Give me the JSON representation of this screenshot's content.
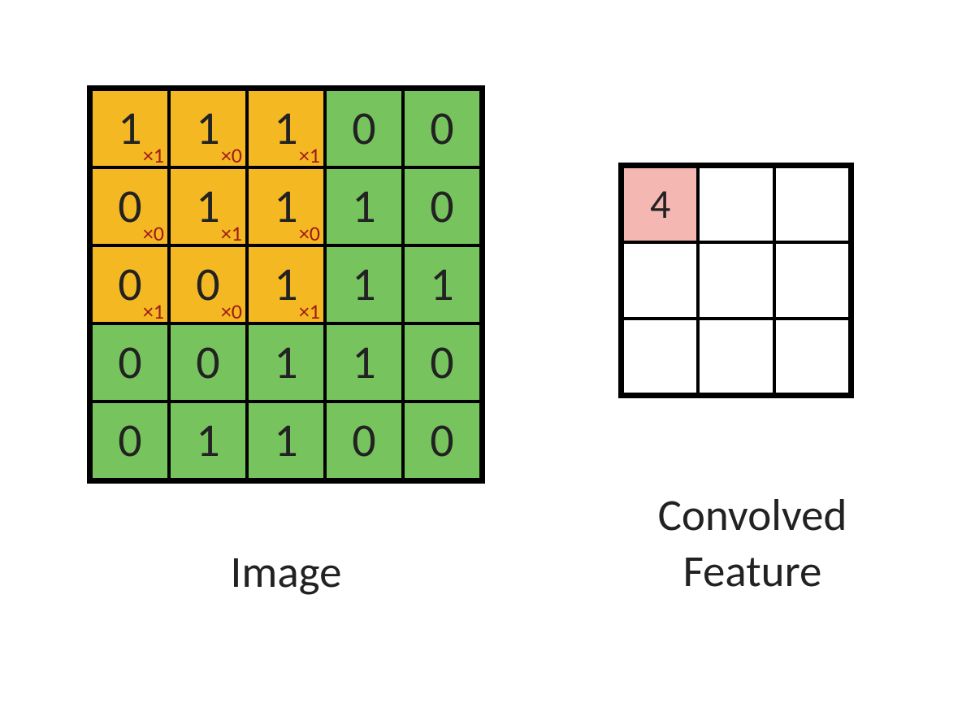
{
  "labels": {
    "image": "Image",
    "feature": "Convolved Feature"
  },
  "colors": {
    "image_cell": "#77c35d",
    "filter_cell": "#f4b823",
    "active_cell": "#f4b7b2",
    "empty_cell": "#ffffff",
    "weight_text": "#a01818",
    "border": "#000000"
  },
  "image_grid": {
    "rows": 5,
    "cols": 5,
    "filter_window": {
      "row0": 0,
      "col0": 0,
      "size": 3
    },
    "cells": [
      [
        {
          "v": "1",
          "w": "×1"
        },
        {
          "v": "1",
          "w": "×0"
        },
        {
          "v": "1",
          "w": "×1"
        },
        {
          "v": "0"
        },
        {
          "v": "0"
        }
      ],
      [
        {
          "v": "0",
          "w": "×0"
        },
        {
          "v": "1",
          "w": "×1"
        },
        {
          "v": "1",
          "w": "×0"
        },
        {
          "v": "1"
        },
        {
          "v": "0"
        }
      ],
      [
        {
          "v": "0",
          "w": "×1"
        },
        {
          "v": "0",
          "w": "×0"
        },
        {
          "v": "1",
          "w": "×1"
        },
        {
          "v": "1"
        },
        {
          "v": "1"
        }
      ],
      [
        {
          "v": "0"
        },
        {
          "v": "0"
        },
        {
          "v": "1"
        },
        {
          "v": "1"
        },
        {
          "v": "0"
        }
      ],
      [
        {
          "v": "0"
        },
        {
          "v": "1"
        },
        {
          "v": "1"
        },
        {
          "v": "0"
        },
        {
          "v": "0"
        }
      ]
    ]
  },
  "feature_grid": {
    "rows": 3,
    "cols": 3,
    "active": {
      "row": 0,
      "col": 0
    },
    "cells": [
      [
        {
          "v": "4"
        },
        {
          "v": ""
        },
        {
          "v": ""
        }
      ],
      [
        {
          "v": ""
        },
        {
          "v": ""
        },
        {
          "v": ""
        }
      ],
      [
        {
          "v": ""
        },
        {
          "v": ""
        },
        {
          "v": ""
        }
      ]
    ]
  }
}
